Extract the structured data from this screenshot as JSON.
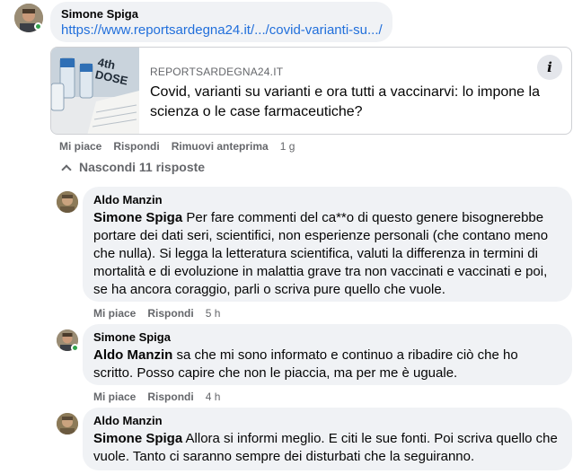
{
  "post_comment": {
    "author": "Simone Spiga",
    "link_text": "https://www.reportsardegna24.it/.../covid-varianti-su.../",
    "preview": {
      "thumb_text": "4th DOSE",
      "source": "REPORTSARDEGNA24.IT",
      "title": "Covid, varianti su varianti e ora tutti a vaccinarvi: lo impone la scienza o le case farmaceutiche?",
      "info_glyph": "i"
    },
    "actions": {
      "like": "Mi piace",
      "reply": "Rispondi",
      "remove_preview": "Rimuovi anteprima",
      "time": "1 g"
    }
  },
  "replies_toggle": {
    "label": "Nascondi 11 risposte"
  },
  "replies": [
    {
      "author": "Aldo Manzin",
      "mention": "Simone Spiga",
      "text": "Per fare commenti del ca**o di questo genere bisognerebbe portare dei dati seri, scientifici, non esperienze personali (che contano meno che nulla). Si legga la letteratura scientifica, valuti la differenza in termini di mortalità e di evoluzione in malattia grave tra non vaccinati e vaccinati e poi, se ha ancora coraggio, parli o scriva pure quello che vuole.",
      "like": "Mi piace",
      "reply": "Rispondi",
      "time": "5 h"
    },
    {
      "author": "Simone Spiga",
      "mention": "Aldo Manzin",
      "text": "sa che mi sono informato e continuo a ribadire ciò che ho scritto. Posso capire che non le piaccia, ma per me è uguale.",
      "like": "Mi piace",
      "reply": "Rispondi",
      "time": "4 h"
    },
    {
      "author": "Aldo Manzin",
      "mention": "Simone Spiga",
      "text": "Allora si informi meglio. E citi le sue fonti. Poi scriva quello che vuole. Tanto ci saranno sempre dei disturbati che la seguiranno."
    }
  ],
  "colors": {
    "link": "#216fdb",
    "bubble": "#f0f2f5",
    "meta": "#65676b",
    "online": "#31a24c"
  }
}
